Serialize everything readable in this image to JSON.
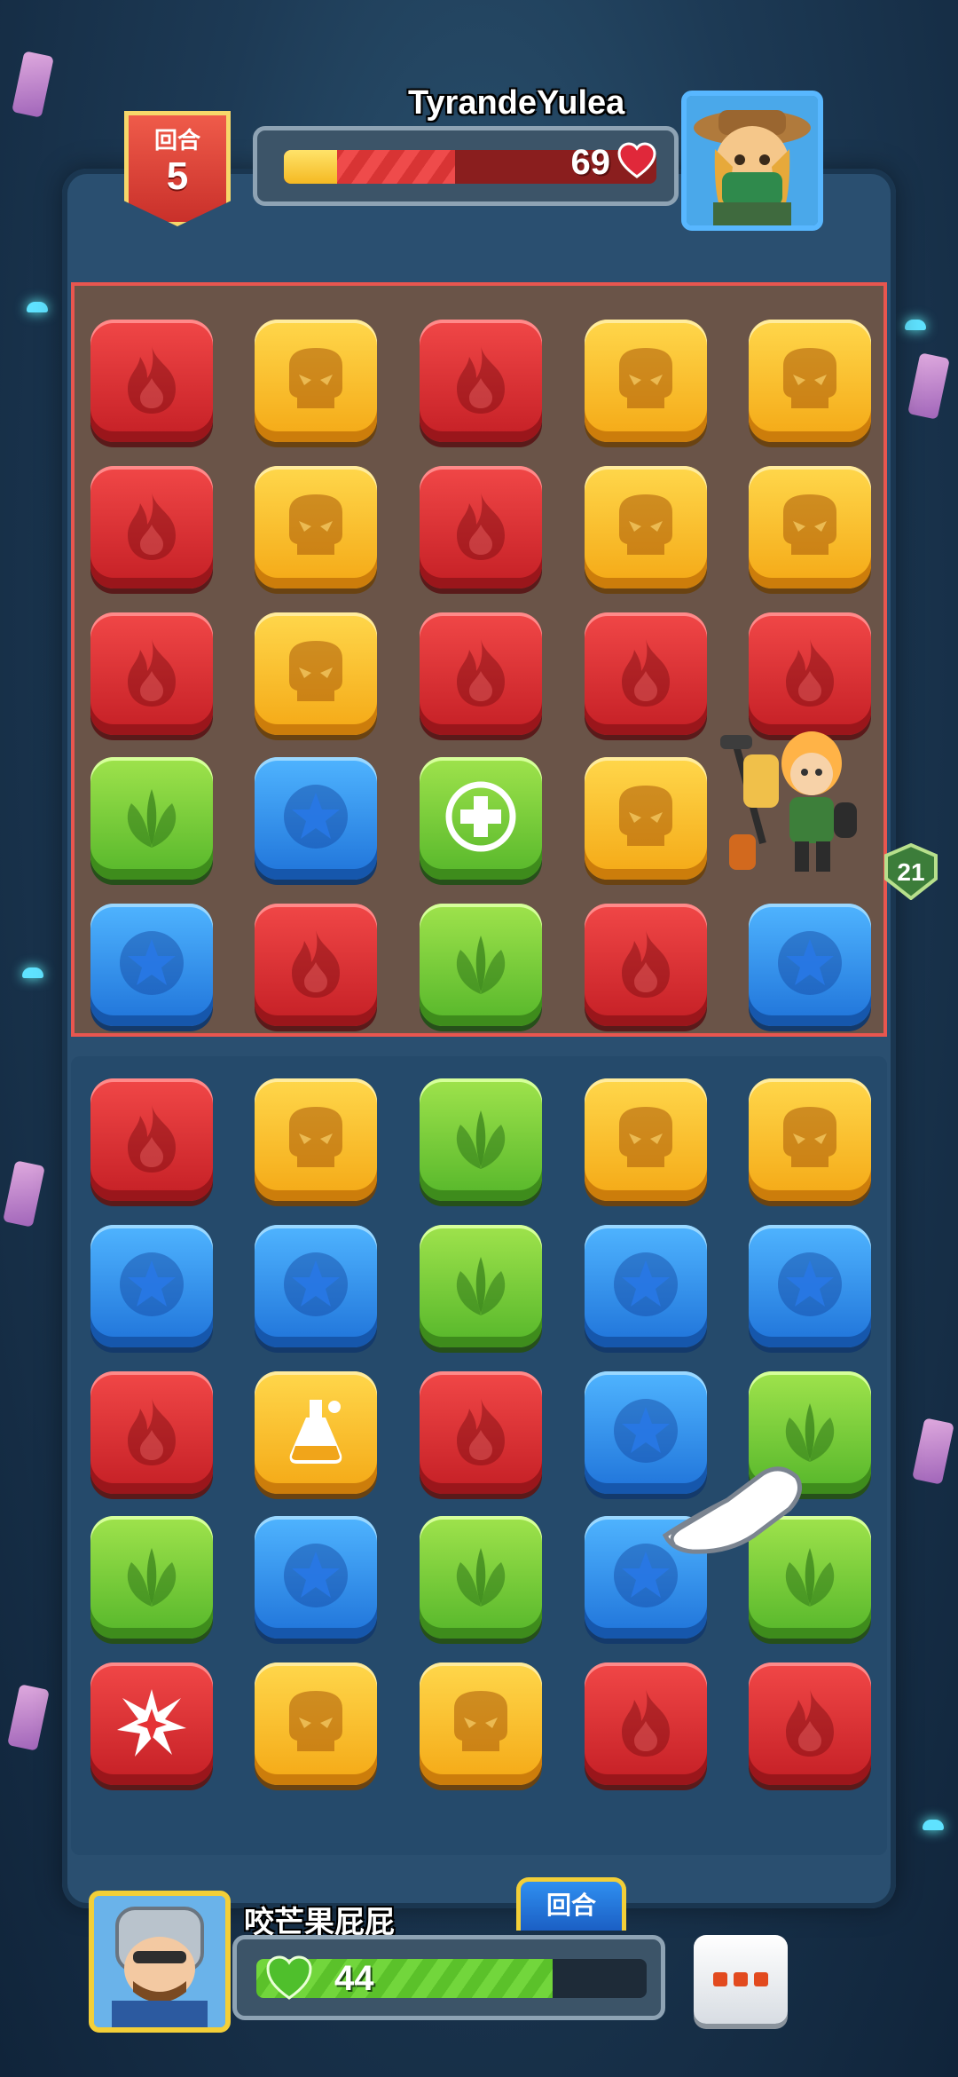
{
  "colors": {
    "red": "#e53235",
    "yellow": "#f7bb26",
    "green": "#7ccd3b",
    "blue": "#2f8ff0",
    "enemy_zone_border": "#e8564f"
  },
  "top_hud": {
    "round_label": "回合",
    "round_number": "5",
    "enemy_name": "TyrandeYulea",
    "enemy_hp": "69",
    "enemy_hp_ratio": 0.46
  },
  "enemy_board": [
    [
      "red",
      "yellow",
      "red",
      "yellow",
      "yellow"
    ],
    [
      "red",
      "yellow",
      "red",
      "yellow",
      "yellow"
    ],
    [
      "red",
      "yellow",
      "red",
      "red",
      "red"
    ],
    [
      "green",
      "blue",
      "green-heal",
      "yellow",
      "hero"
    ],
    [
      "blue",
      "red",
      "green",
      "red",
      "blue"
    ]
  ],
  "hero_level": "21",
  "player_board": [
    [
      "red",
      "yellow",
      "green",
      "yellow",
      "yellow"
    ],
    [
      "blue",
      "blue",
      "green",
      "blue",
      "blue"
    ],
    [
      "red",
      "yellow-potion",
      "red",
      "blue",
      "green"
    ],
    [
      "green",
      "blue",
      "green",
      "blue",
      "green"
    ],
    [
      "red-burst",
      "yellow",
      "yellow",
      "red",
      "red"
    ]
  ],
  "bottom_hud": {
    "player_name": "咬芒果屁屁",
    "turn_label": "回合",
    "player_hp": "44",
    "player_hp_ratio": 0.76
  }
}
